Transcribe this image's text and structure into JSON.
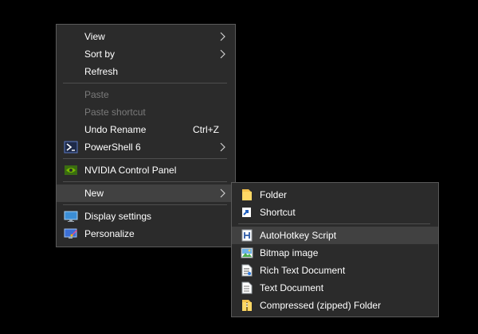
{
  "main_menu": {
    "items": [
      {
        "label": "View"
      },
      {
        "label": "Sort by"
      },
      {
        "label": "Refresh"
      },
      {
        "label": "Paste"
      },
      {
        "label": "Paste shortcut"
      },
      {
        "label": "Undo Rename",
        "shortcut": "Ctrl+Z"
      },
      {
        "label": "PowerShell 6"
      },
      {
        "label": "NVIDIA Control Panel"
      },
      {
        "label": "New"
      },
      {
        "label": "Display settings"
      },
      {
        "label": "Personalize"
      }
    ]
  },
  "sub_menu": {
    "items": [
      {
        "label": "Folder"
      },
      {
        "label": "Shortcut"
      },
      {
        "label": "AutoHotkey Script"
      },
      {
        "label": "Bitmap image"
      },
      {
        "label": "Rich Text Document"
      },
      {
        "label": "Text Document"
      },
      {
        "label": "Compressed (zipped) Folder"
      }
    ]
  },
  "colors": {
    "menu_bg": "#2b2b2b",
    "highlight": "#414141",
    "disabled_text": "#7a7a7a",
    "border": "#5a5a5a"
  }
}
